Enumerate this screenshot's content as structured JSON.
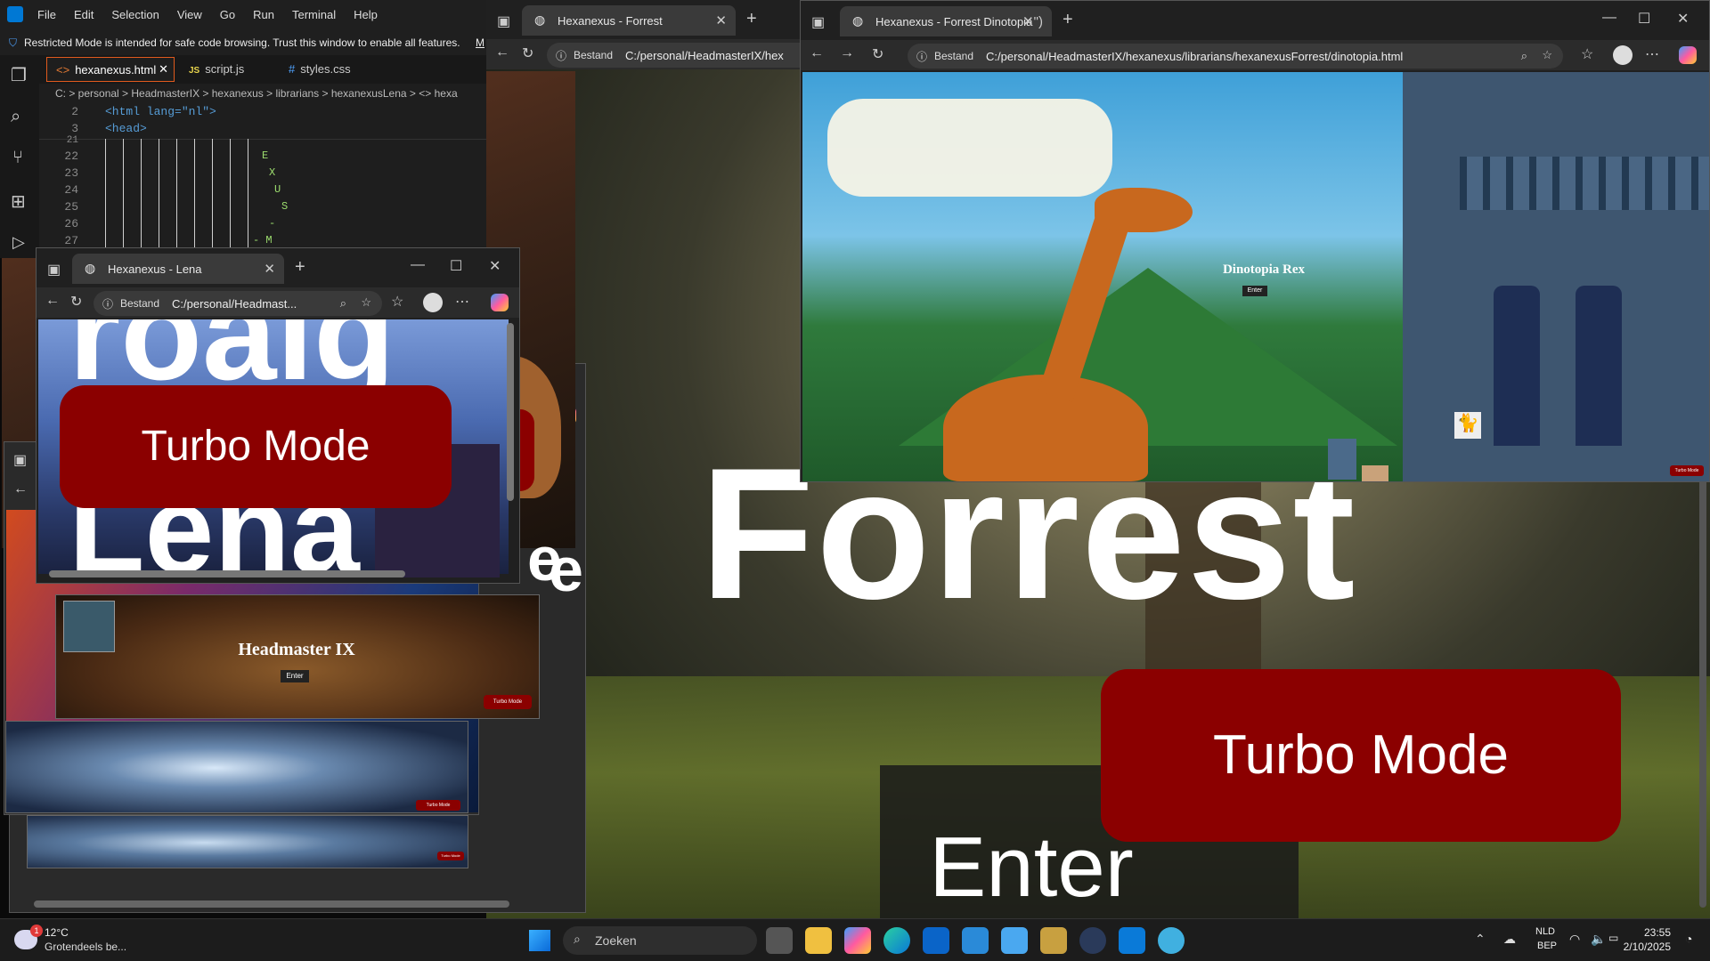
{
  "vscode": {
    "menu": [
      "File",
      "Edit",
      "Selection",
      "View",
      "Go",
      "Run",
      "Terminal",
      "Help"
    ],
    "banner": "Restricted Mode is intended for safe code browsing. Trust this window to enable all features.",
    "banner_more": "M",
    "tabs": [
      {
        "label": "hexanexus.html",
        "icon": "<>"
      },
      {
        "label": "script.js",
        "icon": "JS"
      },
      {
        "label": "styles.css",
        "icon": "#"
      }
    ],
    "breadcrumb": "C: > personal > HeadmasterIX > hexanexus > librarians > hexanexusLena > <> hexa",
    "lines": [
      {
        "n": "2",
        "code": "<html lang=\"nl\">"
      },
      {
        "n": "3",
        "code": "<head>"
      },
      {
        "n": "21",
        "code": ""
      },
      {
        "n": "22",
        "code": "E"
      },
      {
        "n": "23",
        "code": "X"
      },
      {
        "n": "24",
        "code": "U"
      },
      {
        "n": "25",
        "code": "S"
      },
      {
        "n": "26",
        "code": "-"
      },
      {
        "n": "27",
        "code": "- M"
      }
    ]
  },
  "browser_forrest": {
    "tab_title": "Hexanexus - Forrest",
    "tab_title_2": "Hexanexus - Forrest Dinotopia",
    "bestand": "Bestand",
    "url": "C:/personal/HeadmasterIX/hexanexus/librarians/hexanexusForrest/dinotopia.html",
    "url_short": "C:/personal/HeadmasterIX/hex",
    "heading": "Forrest",
    "turbo": "Turbo Mode",
    "enter": "Enter"
  },
  "dinotopia": {
    "title": "Dinotopia Rex",
    "enter": "Enter",
    "turbo": "Turbo Mode"
  },
  "browser_lena": {
    "tab_title": "Hexanexus - Lena",
    "bestand": "Bestand",
    "url": "C:/personal/Headmast...",
    "heading_top": "roaig",
    "heading_bottom": "Lena",
    "turbo": "Turbo Mode"
  },
  "headmaster": {
    "title": "Headmaster IX",
    "enter": "Enter",
    "turbo": "Turbo Mode"
  },
  "back_windows": {
    "turbo": "Turbo Mode",
    "e_letter": "e",
    "e_letter_2": "e"
  },
  "taskbar": {
    "weather_temp": "12°C",
    "weather_desc": "Grotendeels be...",
    "weather_badge": "1",
    "search": "Zoeken",
    "lang_top": "NLD",
    "lang_bottom": "BEP",
    "time": "23:55",
    "date": "2/10/2025"
  }
}
